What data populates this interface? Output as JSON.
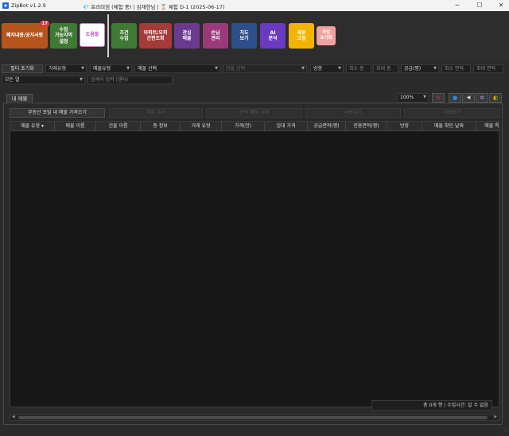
{
  "window": {
    "title": "ZipBot v1.2.9",
    "status": "💎 프리미엄 (체험 중) | 김재현님 | ⌛ 체험 D-1 (2025-06-17)",
    "minimize": "─",
    "maximize": "☐",
    "close": "✕"
  },
  "toolbar": {
    "buttons": [
      {
        "label": "폐지내용/공지사항",
        "color": "#b5541c",
        "badge": "17"
      },
      {
        "label": "수집\n가능지역\n설정",
        "color": "#3f7a35"
      },
      {
        "label": "도움말",
        "color": "#ffffff"
      },
      {
        "label": "조건\n수집",
        "color": "#3f7a35"
      },
      {
        "label": "아파트/오피\n간편조회",
        "color": "#a63a3a"
      },
      {
        "label": "관심\n매물",
        "color": "#6a3a8e"
      },
      {
        "label": "손님\n관리",
        "color": "#9b3a7a"
      },
      {
        "label": "지도\n보기",
        "color": "#2f4f8a"
      },
      {
        "label": "AI\n분석",
        "color": "#6a3ac2"
      },
      {
        "label": "새로\n고침",
        "color": "#f2b400"
      },
      {
        "label": "작업\n초기화",
        "color": "#f2a0a0"
      }
    ]
  },
  "filters": {
    "reset": "필터 초기화",
    "trade_type": "거래유형",
    "property_type": "매물유형",
    "property_select": "매물 선택",
    "building_select": "건물 선택",
    "direction": "방향",
    "min_floor": "최소 층",
    "max_floor": "최대 층",
    "supply": "공급(평)",
    "min_area": "최소 면적",
    "max_area": "최대 면적",
    "all_columns": "모든 열",
    "search_placeholder": "검색어 입력 (엔터)"
  },
  "tab": {
    "label": "내 매물"
  },
  "panel": {
    "zoom": "100%",
    "icons": [
      "pin-icon",
      "circle-blue-icon",
      "arrow-left-icon",
      "gear-icon",
      "moon-icon"
    ],
    "import_btn": "부동산 포털 내 매물 가져오기",
    "add_btn": "매물 추가",
    "delete_btn": "선택 매물 삭제",
    "export_btn": "내보내기",
    "import2_btn": "가져오기"
  },
  "table": {
    "columns": [
      "매물 유형",
      "매물 이름",
      "건물 이름",
      "층 정보",
      "거래 유형",
      "가격(만)",
      "임대 가격",
      "공급면적(평)",
      "전용면적(평)",
      "방향",
      "매물 확인 날짜",
      "매물 특"
    ],
    "status": "총 0개 행 | 수집시간: 알 수 없음"
  }
}
